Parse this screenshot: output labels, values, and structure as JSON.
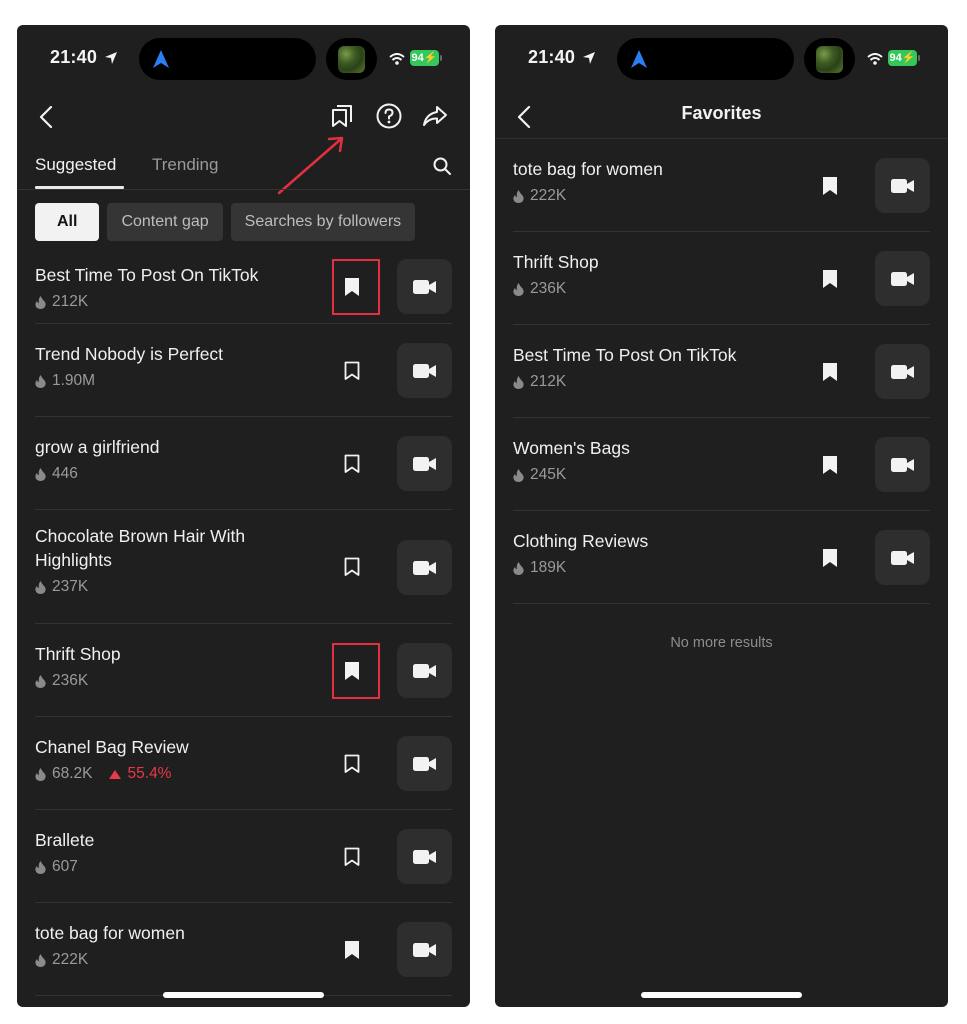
{
  "status_bar": {
    "time": "21:40",
    "battery": "94"
  },
  "left_screen": {
    "header": {
      "icons": [
        "back-icon",
        "favorites-bookmark-icon",
        "help-icon",
        "share-icon"
      ]
    },
    "tabs": [
      {
        "label": "Suggested",
        "active": true
      },
      {
        "label": "Trending",
        "active": false
      }
    ],
    "filters": [
      {
        "label": "All",
        "selected": true
      },
      {
        "label": "Content gap",
        "selected": false
      },
      {
        "label": "Searches by followers",
        "selected": false
      }
    ],
    "items": [
      {
        "title": "Best Time To Post On TikTok",
        "count": "212K",
        "bookmarked": true,
        "highlighted": true
      },
      {
        "title": "Trend Nobody is Perfect",
        "count": "1.90M",
        "bookmarked": false
      },
      {
        "title": "grow a girlfriend",
        "count": "446",
        "bookmarked": false
      },
      {
        "title": "Chocolate Brown Hair With Highlights",
        "count": "237K",
        "bookmarked": false
      },
      {
        "title": "Thrift Shop",
        "count": "236K",
        "bookmarked": true,
        "highlighted": true
      },
      {
        "title": "Chanel Bag Review",
        "count": "68.2K",
        "trend": "55.4%",
        "bookmarked": false
      },
      {
        "title": "Brallete",
        "count": "607",
        "bookmarked": false
      },
      {
        "title": "tote bag for women",
        "count": "222K",
        "bookmarked": true
      }
    ]
  },
  "right_screen": {
    "header": {
      "title": "Favorites"
    },
    "items": [
      {
        "title": "tote bag for women",
        "count": "222K",
        "bookmarked": true
      },
      {
        "title": "Thrift Shop",
        "count": "236K",
        "bookmarked": true
      },
      {
        "title": "Best Time To Post On TikTok",
        "count": "212K",
        "bookmarked": true
      },
      {
        "title": "Women's Bags",
        "count": "245K",
        "bookmarked": true
      },
      {
        "title": "Clothing Reviews",
        "count": "189K",
        "bookmarked": true
      }
    ],
    "footer": "No more results"
  },
  "colors": {
    "accent_red": "#e23040",
    "trend_red": "#e8394a",
    "battery_green": "#34c759",
    "background": "#1f1f1f"
  }
}
